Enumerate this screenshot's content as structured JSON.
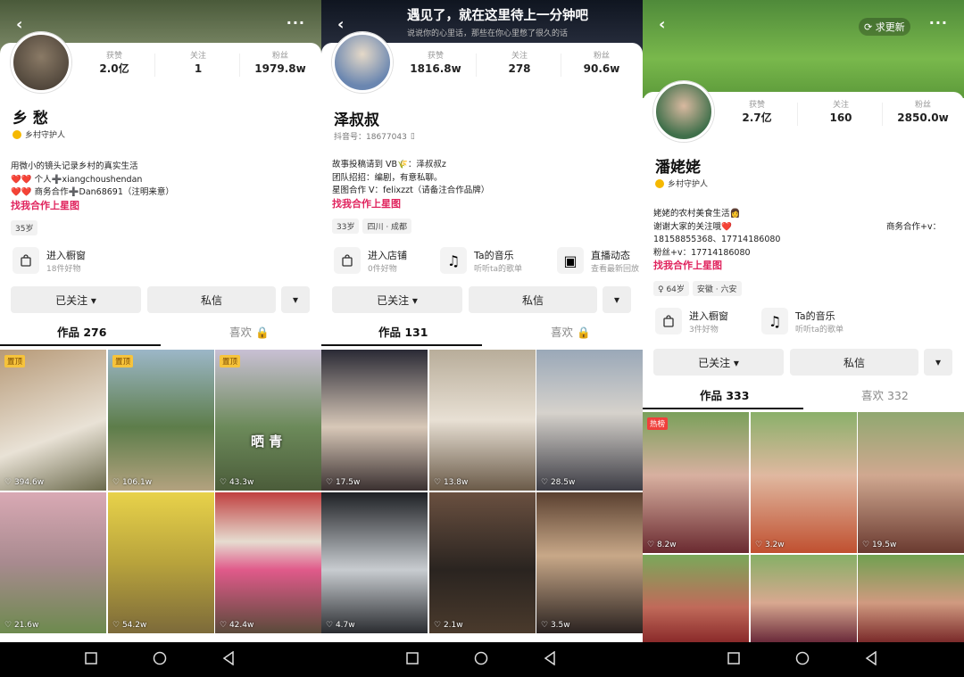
{
  "colors": {
    "pink": "#e0245e",
    "gold": "#f5b800"
  },
  "panels": [
    {
      "name": "乡 愁",
      "badge": "乡村守护人",
      "stats": [
        {
          "label": "获赞",
          "value": "2.0亿"
        },
        {
          "label": "关注",
          "value": "1"
        },
        {
          "label": "粉丝",
          "value": "1979.8w"
        }
      ],
      "bio": [
        "用微小的镜头记录乡村的真实生活",
        "❤️❤️ 个人➕xiangchoushendan",
        "❤️❤️ 商务合作➕Dan68691（注明来意）"
      ],
      "link": "找我合作上星图",
      "tags": [
        "35岁"
      ],
      "shops": [
        {
          "title": "进入橱窗",
          "sub": "18件好物"
        }
      ],
      "follow": "已关注 ▾",
      "message": "私信",
      "tab_works": "作品 276",
      "tab_likes": "喜欢",
      "likes": [
        "394.6w",
        "106.1w",
        "43.3w",
        "21.6w",
        "54.2w",
        "42.4w"
      ],
      "pins": [
        "置顶",
        "置顶",
        "置顶"
      ],
      "cell_captions": [
        "晒 青"
      ]
    },
    {
      "banner_title": "遇见了，就在这里待上一分钟吧",
      "banner_sub": "说说你的心里话，那些在你心里憋了很久的话",
      "name": "泽叔叔",
      "douyin_id": "抖音号：18677043",
      "stats": [
        {
          "label": "获赞",
          "value": "1816.8w"
        },
        {
          "label": "关注",
          "value": "278"
        },
        {
          "label": "粉丝",
          "value": "90.6w"
        }
      ],
      "bio": [
        "故事投稿请到 VB🌾：泽叔叔z",
        "团队招招：编剧，有意私聊。",
        "星图合作 V：felixzzt（请备注合作品牌）"
      ],
      "link": "找我合作上星图",
      "tags": [
        "33岁",
        "四川 · 成都"
      ],
      "shops": [
        {
          "title": "进入店铺",
          "sub": "0件好物"
        },
        {
          "title": "Ta的音乐",
          "sub": "听听ta的歌单"
        },
        {
          "title": "直播动态",
          "sub": "查看最新回放"
        }
      ],
      "follow": "已关注 ▾",
      "message": "私信",
      "tab_works": "作品 131",
      "tab_likes": "喜欢",
      "likes": [
        "17.5w",
        "13.8w",
        "28.5w",
        "4.7w",
        "2.1w",
        "3.5w"
      ]
    },
    {
      "banner_update": "求更新",
      "name": "潘姥姥",
      "badge": "乡村守护人",
      "stats": [
        {
          "label": "获赞",
          "value": "2.7亿"
        },
        {
          "label": "关注",
          "value": "160"
        },
        {
          "label": "粉丝",
          "value": "2850.0w"
        }
      ],
      "bio": [
        "姥姥的农村美食生活👩",
        "谢谢大家的关注哦❤️",
        "18158855368、17714186080",
        "粉丝+v：17714186080"
      ],
      "bio_right": "商务合作+v：",
      "link": "找我合作上星图",
      "tags": [
        "♀ 64岁",
        "安徽 · 六安"
      ],
      "shops": [
        {
          "title": "进入橱窗",
          "sub": "3件好物"
        },
        {
          "title": "Ta的音乐",
          "sub": "听听ta的歌单"
        }
      ],
      "follow": "已关注 ▾",
      "message": "私信",
      "tab_works": "作品 333",
      "tab_likes": "喜欢 332",
      "likes": [
        "8.2w",
        "3.2w",
        "19.5w"
      ],
      "pins": [
        "热榜"
      ]
    }
  ]
}
